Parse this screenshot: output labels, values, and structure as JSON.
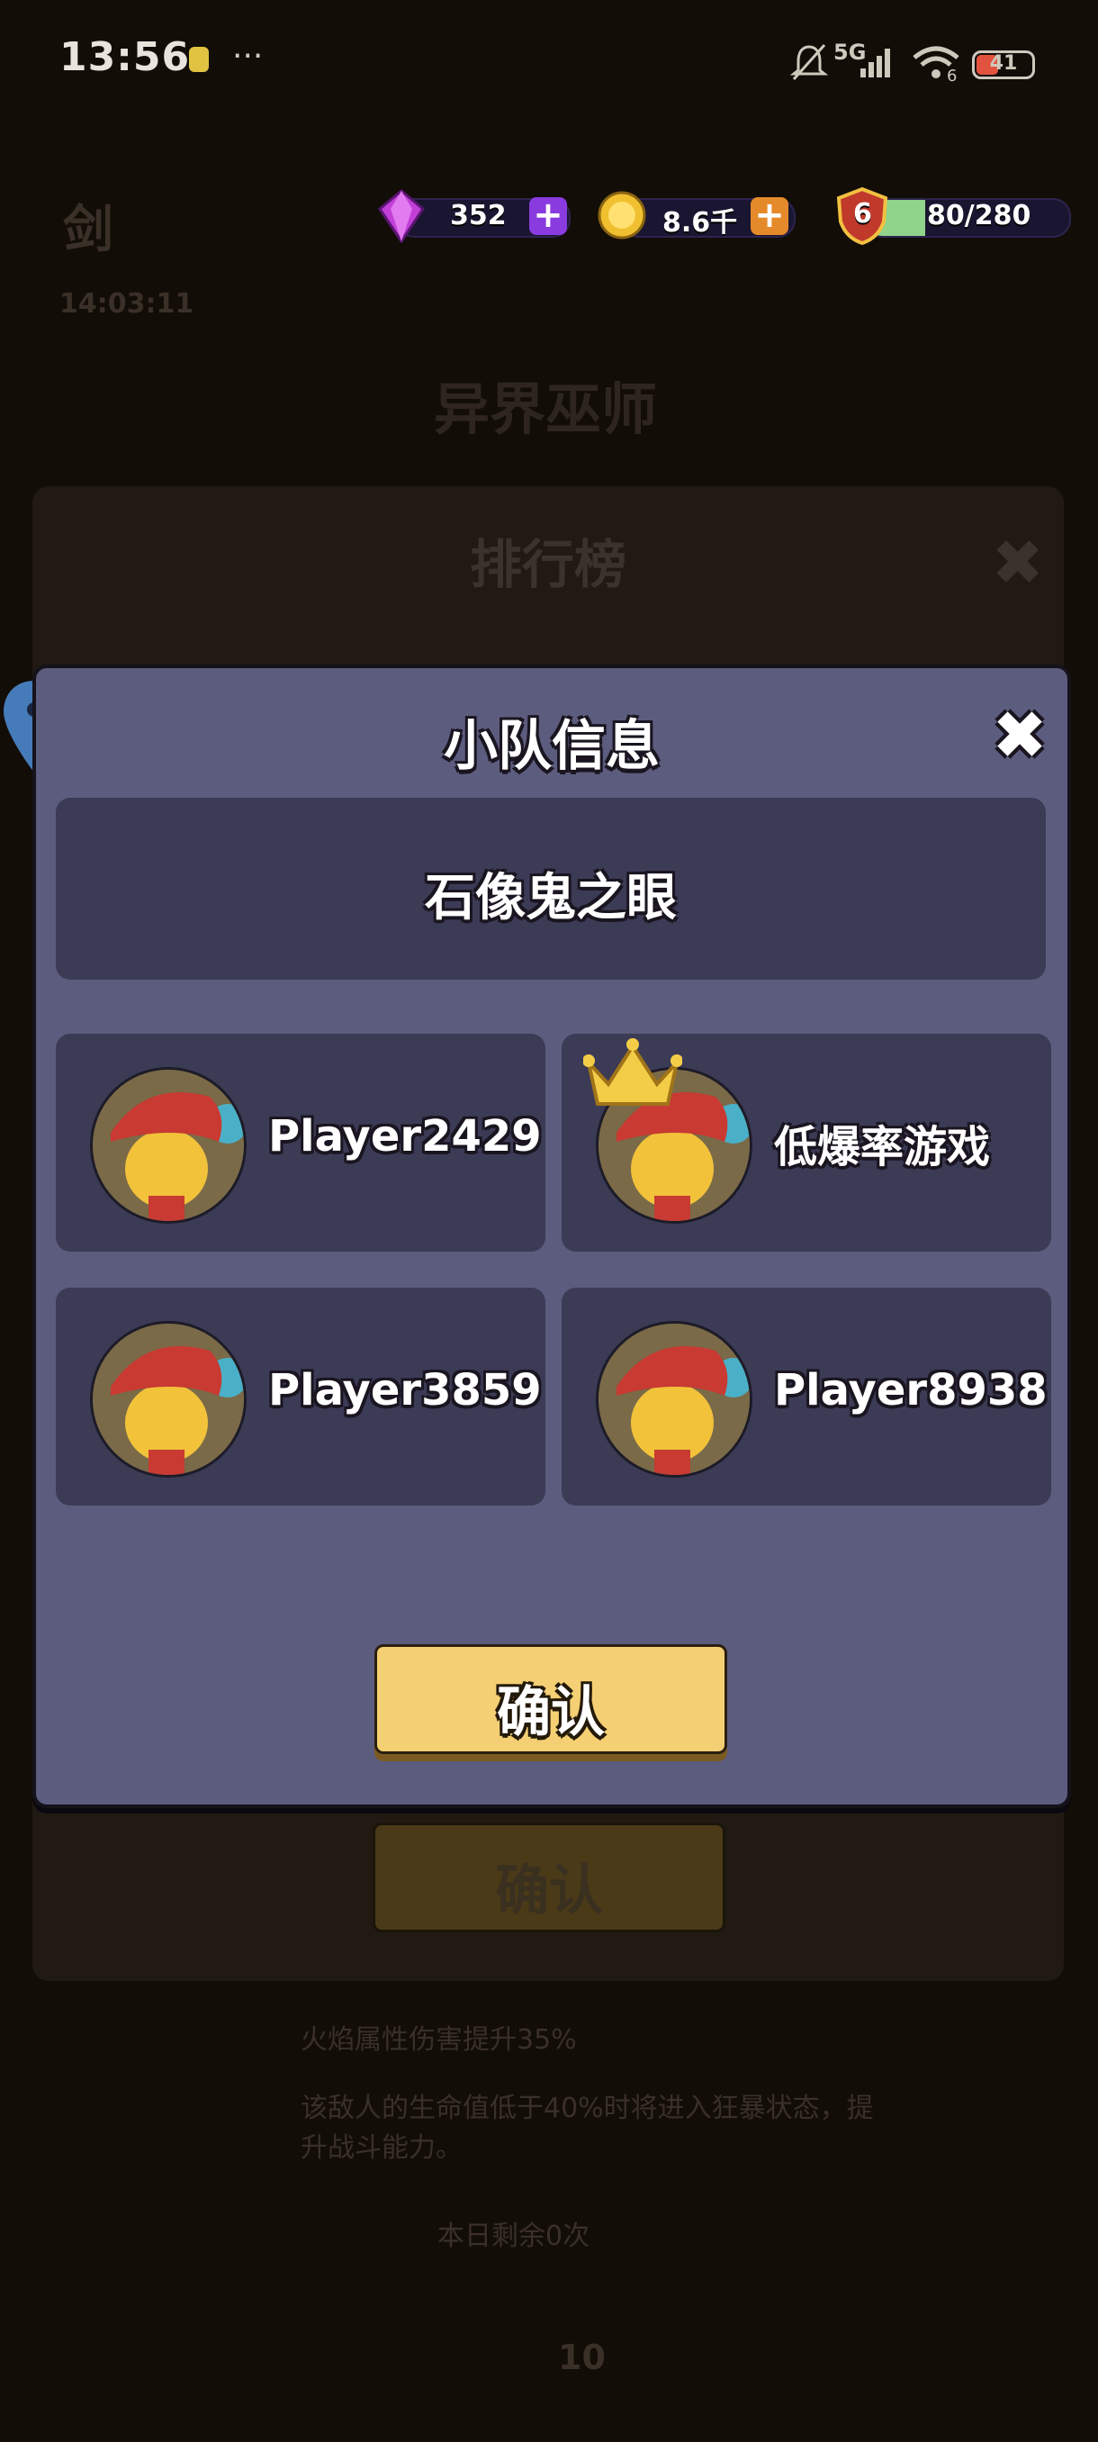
{
  "status_bar": {
    "time": "13:56",
    "more_dots": "···",
    "network": "5G",
    "wifi_badge": "6",
    "battery": "41"
  },
  "resources": {
    "gems": "352",
    "gold": "8.6千",
    "level": "6",
    "energy": "80/280"
  },
  "background": {
    "title_partial": "剑",
    "timer": "14:03:11",
    "boss_name": "异界巫师",
    "rank_title": "排行榜",
    "confirm_label": "确认",
    "skill_1": "火焰属性伤害提升35%",
    "skill_2": "该敌人的生命值低于40%时将进入狂暴状态，提升战斗能力。",
    "remaining": "本日剩余0次",
    "cost": "10"
  },
  "modal": {
    "title": "小队信息",
    "team_name": "石像鬼之眼",
    "members": [
      {
        "name": "Player2429",
        "leader": false
      },
      {
        "name": "低爆率游戏",
        "leader": true
      },
      {
        "name": "Player3859",
        "leader": false
      },
      {
        "name": "Player8938",
        "leader": false
      }
    ],
    "confirm_label": "确认"
  },
  "colors": {
    "modal_bg": "#5c5c7e",
    "card_bg": "#3b3b56",
    "confirm_bg": "#f4cf73",
    "gem_plus": "#8a3be0",
    "gold_plus": "#e58a2a",
    "energy_fill": "#8fd48a"
  }
}
